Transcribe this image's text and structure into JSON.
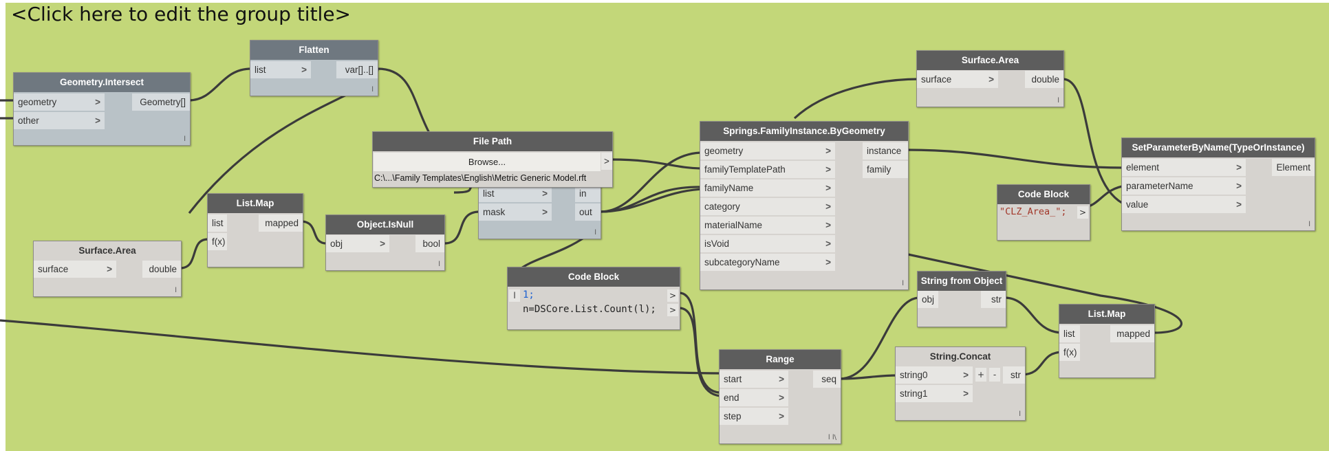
{
  "group": {
    "title": "<Click here to edit the group title>",
    "color": "#c3d779"
  },
  "colors": {
    "node_header": "#5d5d5d",
    "node_body": "#d6d3cf",
    "preview_header": "#6f7880",
    "wire": "#3b3b3b"
  },
  "nodes": {
    "geom_intersect": {
      "title": "Geometry.Intersect",
      "inputs": [
        "geometry",
        "other"
      ],
      "outputs": [
        "Geometry[]"
      ]
    },
    "flatten": {
      "title": "Flatten",
      "inputs": [
        "list"
      ],
      "outputs": [
        "var[]..[]"
      ]
    },
    "surface_area_left": {
      "title": "Surface.Area",
      "inputs": [
        "surface"
      ],
      "outputs": [
        "double"
      ]
    },
    "list_map_left": {
      "title": "List.Map",
      "inputs": [
        "list",
        "f(x)"
      ],
      "outputs": [
        "mapped"
      ]
    },
    "is_null": {
      "title": "Object.IsNull",
      "inputs": [
        "obj"
      ],
      "outputs": [
        "bool"
      ]
    },
    "file_path": {
      "title": "File Path",
      "button": "Browse...",
      "value": "C:\\...\\Family Templates\\English\\Metric Generic Model.rft"
    },
    "filter_mask": {
      "inputs": [
        "list",
        "mask"
      ],
      "outputs": [
        "in",
        "out"
      ]
    },
    "code_block_mid": {
      "title": "Code Block",
      "lines": [
        "1;",
        "n=DSCore.List.Count(l);"
      ]
    },
    "springs": {
      "title": "Springs.FamilyInstance.ByGeometry",
      "inputs": [
        "geometry",
        "familyTemplatePath",
        "familyName",
        "category",
        "materialName",
        "isVoid",
        "subcategoryName"
      ],
      "outputs": [
        "instance",
        "family"
      ]
    },
    "surface_area_top": {
      "title": "Surface.Area",
      "inputs": [
        "surface"
      ],
      "outputs": [
        "double"
      ]
    },
    "set_param": {
      "title": "SetParameterByName(TypeOrInstance)",
      "inputs": [
        "element",
        "parameterName",
        "value"
      ],
      "outputs": [
        "Element"
      ]
    },
    "code_block_right": {
      "title": "Code Block",
      "lines": [
        "\"CLZ_Area_\";"
      ]
    },
    "string_from_object": {
      "title": "String from Object",
      "inputs": [
        "obj"
      ],
      "outputs": [
        "str"
      ]
    },
    "list_map_right": {
      "title": "List.Map",
      "inputs": [
        "list",
        "f(x)"
      ],
      "outputs": [
        "mapped"
      ]
    },
    "range": {
      "title": "Range",
      "inputs": [
        "start",
        "end",
        "step"
      ],
      "outputs": [
        "seq"
      ]
    },
    "string_concat": {
      "title": "String.Concat",
      "inputs": [
        "string0",
        "string1"
      ],
      "outputs": [
        "str"
      ],
      "add": "+",
      "remove": "-"
    }
  },
  "glyphs": {
    "arrow": ">",
    "lacing": "l",
    "lacing_cross": "l l\\",
    "cb_port": "l"
  }
}
